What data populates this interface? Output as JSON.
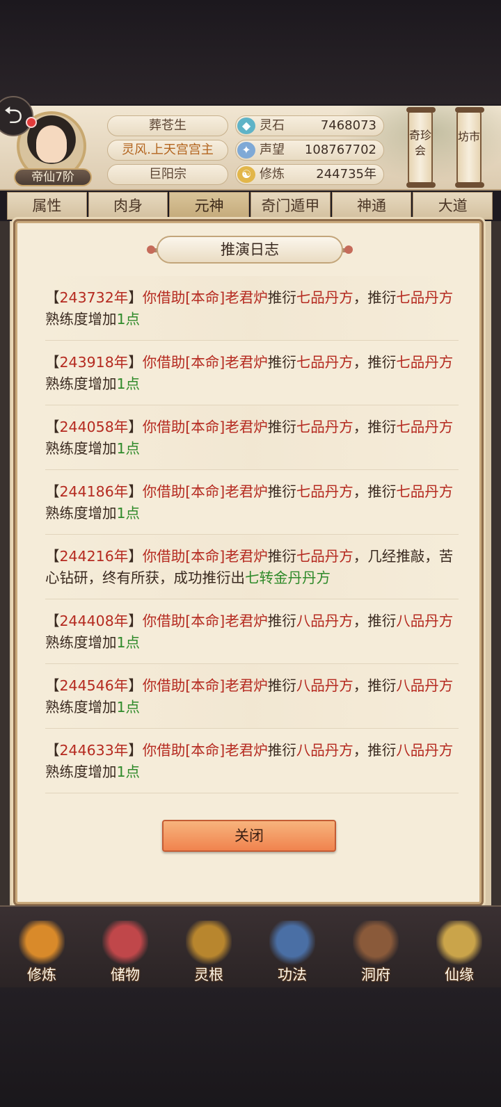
{
  "player": {
    "name": "葬苍生",
    "title": "灵风.上天宫宫主",
    "sect": "巨阳宗",
    "rank": "帝仙7阶"
  },
  "resources": [
    {
      "label": "灵石",
      "value": "7468073",
      "icon": "spirit-stone-icon"
    },
    {
      "label": "声望",
      "value": "108767702",
      "icon": "prestige-icon"
    },
    {
      "label": "修炼",
      "value": "244735年",
      "icon": "cultivation-icon"
    }
  ],
  "side_buttons": {
    "treasure": "奇珍会",
    "market": "坊市"
  },
  "tabs": [
    "属性",
    "肉身",
    "元神",
    "奇门遁甲",
    "神通",
    "大道"
  ],
  "active_tab": "元神",
  "modal": {
    "title": "推演日志",
    "close_label": "关闭",
    "entries": [
      {
        "open": "【",
        "year": "243732年",
        "close": "】",
        "t1": "你借助",
        "tool": "[本命]老君炉",
        "t2": "推衍",
        "item": "七品丹方",
        "t3": "，推衍",
        "item2": "七品丹方",
        "t4": "熟练度增加",
        "gain": "1点"
      },
      {
        "open": "【",
        "year": "243918年",
        "close": "】",
        "t1": "你借助",
        "tool": "[本命]老君炉",
        "t2": "推衍",
        "item": "七品丹方",
        "t3": "，推衍",
        "item2": "七品丹方",
        "t4": "熟练度增加",
        "gain": "1点"
      },
      {
        "open": "【",
        "year": "244058年",
        "close": "】",
        "t1": "你借助",
        "tool": "[本命]老君炉",
        "t2": "推衍",
        "item": "七品丹方",
        "t3": "，推衍",
        "item2": "七品丹方",
        "t4": "熟练度增加",
        "gain": "1点"
      },
      {
        "open": "【",
        "year": "244186年",
        "close": "】",
        "t1": "你借助",
        "tool": "[本命]老君炉",
        "t2": "推衍",
        "item": "七品丹方",
        "t3": "，推衍",
        "item2": "七品丹方",
        "t4": "熟练度增加",
        "gain": "1点"
      },
      {
        "open": "【",
        "year": "244216年",
        "close": "】",
        "t1": "你借助",
        "tool": "[本命]老君炉",
        "t2": "推衍",
        "item": "七品丹方",
        "t3": "，几经推敲，苦心钻研，终有所获，成功推衍出",
        "item2": "",
        "t4": "",
        "gain": "七转金丹丹方"
      },
      {
        "open": "【",
        "year": "244408年",
        "close": "】",
        "t1": "你借助",
        "tool": "[本命]老君炉",
        "t2": "推衍",
        "item": "八品丹方",
        "t3": "，推衍",
        "item2": "八品丹方",
        "t4": "熟练度增加",
        "gain": "1点"
      },
      {
        "open": "【",
        "year": "244546年",
        "close": "】",
        "t1": "你借助",
        "tool": "[本命]老君炉",
        "t2": "推衍",
        "item": "八品丹方",
        "t3": "，推衍",
        "item2": "八品丹方",
        "t4": "熟练度增加",
        "gain": "1点"
      },
      {
        "open": "【",
        "year": "244633年",
        "close": "】",
        "t1": "你借助",
        "tool": "[本命]老君炉",
        "t2": "推衍",
        "item": "八品丹方",
        "t3": "，推衍",
        "item2": "八品丹方",
        "t4": "熟练度增加",
        "gain": "1点"
      }
    ]
  },
  "bottom_nav": [
    {
      "label": "修炼",
      "icon": "cultivate-icon",
      "color": "#d98a2a"
    },
    {
      "label": "储物",
      "icon": "storage-bag-icon",
      "color": "#c0474a"
    },
    {
      "label": "灵根",
      "icon": "spirit-root-icon",
      "color": "#b8862e"
    },
    {
      "label": "功法",
      "icon": "technique-book-icon",
      "color": "#4a6fa5"
    },
    {
      "label": "洞府",
      "icon": "cave-dwelling-icon",
      "color": "#8a5a3a"
    },
    {
      "label": "仙缘",
      "icon": "immortal-fate-icon",
      "color": "#caa44a"
    }
  ],
  "colors": {
    "accent_red": "#b52a20",
    "accent_green": "#2f8a2a",
    "close_button": "#f0834e"
  }
}
